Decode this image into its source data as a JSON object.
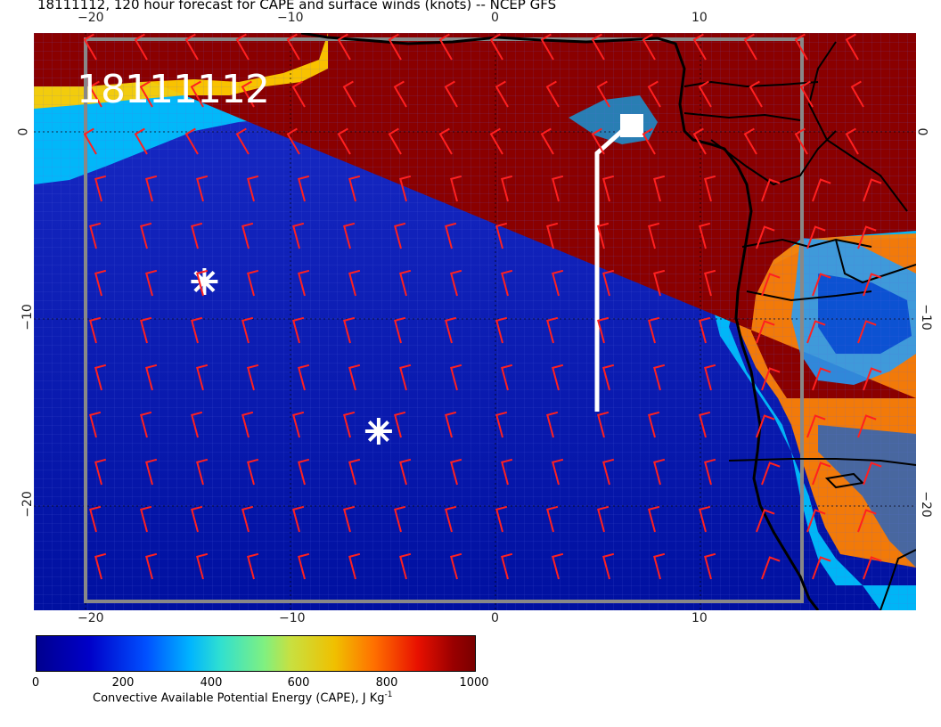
{
  "title": "18111112, 120 hour forecast for CAPE and surface winds (knots) -- NCEP GFS",
  "stamp": "18111112",
  "lon_ticks_top": [
    "−20",
    "−10",
    "0",
    "10"
  ],
  "lon_ticks_bottom": [
    "−20",
    "−10",
    "0",
    "10"
  ],
  "lat_ticks_left": [
    "0",
    "−10",
    "−20"
  ],
  "lat_ticks_right": [
    "0",
    "−10",
    "−20"
  ],
  "colorbar": {
    "ticks": [
      "0",
      "200",
      "400",
      "600",
      "800",
      "1000"
    ],
    "label": "Convective Available Potential Energy (CAPE), J Kg",
    "label_sup": "-1"
  },
  "colors": {
    "low": "#00008f",
    "mid": "#30e0d0",
    "high": "#7a0000",
    "barb": "#ff2020",
    "coast": "#000000"
  },
  "markers": [
    {
      "name": "star-marker-west",
      "lon": -14.2,
      "lat": -8
    },
    {
      "name": "star-marker-east",
      "lon": -5.7,
      "lat": -16
    }
  ]
}
